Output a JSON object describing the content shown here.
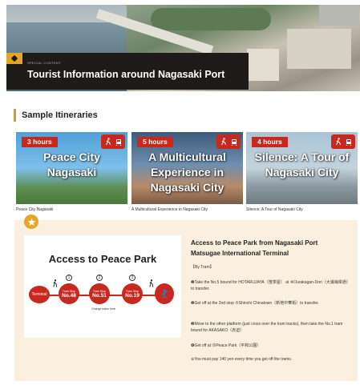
{
  "hero": {
    "tag": "SPECIAL CONTENT",
    "title": "Tourist Information around Nagasaki Port"
  },
  "section": {
    "title": "Sample Itineraries"
  },
  "itineraries": [
    {
      "hours": "3 hours",
      "image_title": "Peace City Nagasaki",
      "caption": "Peace City Nagasaki"
    },
    {
      "hours": "5 hours",
      "image_title": "A Multicultural Experience in Nagasaki City",
      "caption": "A Multicultural Experience in Nagasaki City"
    },
    {
      "hours": "4 hours",
      "image_title": "Silence: A Tour of Nagasaki City",
      "caption": "Silence: A Tour of Nagasaki City"
    }
  ],
  "access": {
    "map_title": "Access to Peace Park",
    "terminal": "Terminal",
    "stops": [
      {
        "top": "Tram Stop",
        "num": "No.48"
      },
      {
        "top": "Tram Stop",
        "num": "No.51"
      },
      {
        "top": "Tram Stop",
        "num": "No.19"
      }
    ],
    "markers": [
      "1",
      "2",
      "3"
    ],
    "change_note": "Change trains here",
    "heading_line1": "Access to Peace Park from Nagasaki Port",
    "heading_line2": "Matsugae International Terminal",
    "lines": [
      "【By Tram】",
      "❶Take the No.5 bound for HOTARUJAYA（蛍茶屋） at ⑧Ourakagan-Dori（大浦海岸通）to transfer.",
      "❷Get off at the 2nd stop ⑤Shinchi Chinatown（新地中華街）to transfer.",
      "❸Move to the other platform (just cross over the tram tracks), then take the No.1 tram bound for AKASAKO（赤迫）",
      "❹Get off at ⑲Peace Park（平和公園）",
      "※You must pay 140 yen every time you get off the trams."
    ]
  },
  "colors": {
    "accent_red": "#c8281e",
    "accent_gold": "#e4a62a",
    "panel_bg": "#fbf0df",
    "hero_panel": "#1f1b1a"
  }
}
